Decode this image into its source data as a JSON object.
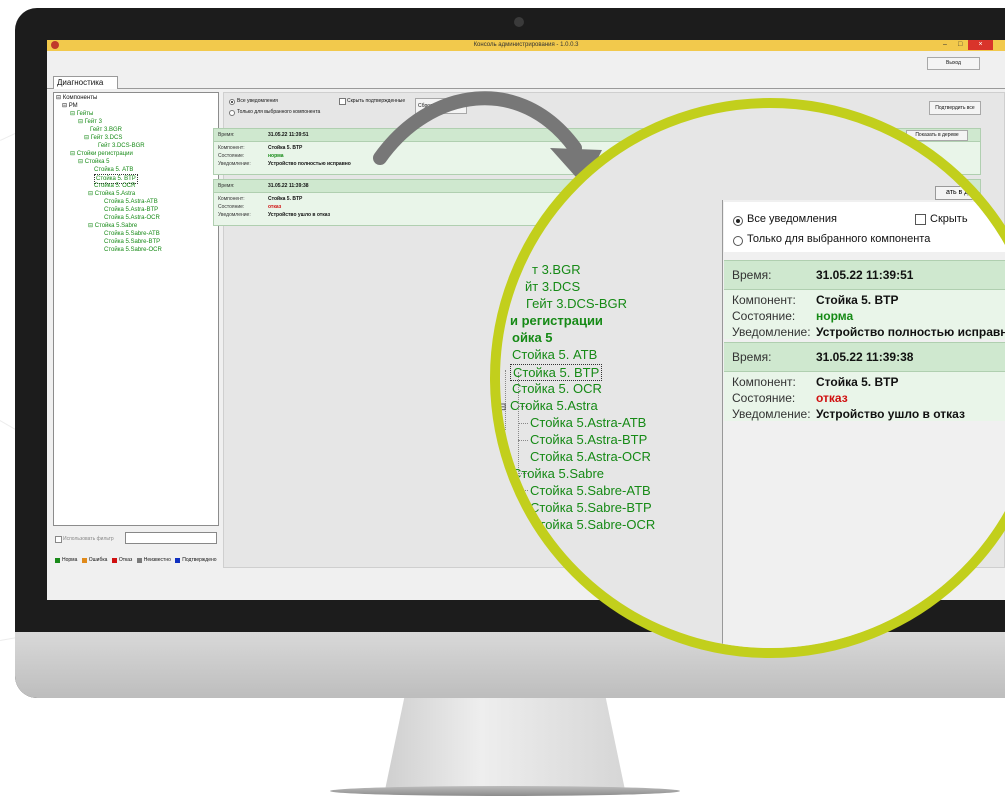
{
  "window": {
    "title": "Консоль администрирования - 1.0.0.3",
    "minimize_glyph": "–",
    "maximize_glyph": "□",
    "close_glyph": "×",
    "exit_label": "Выход"
  },
  "tabs": [
    "Диагностика"
  ],
  "tree": {
    "root": "Компоненты",
    "pm": "РМ",
    "gates": "Гейты",
    "gate3": "Гейт 3",
    "gate3_bgr": "Гейт 3.BGR",
    "gate3_dcs": "Гейт 3.DCS",
    "gate3_dcs_bgr": "Гейт 3.DCS-BGR",
    "counters": "Стойки регистрации",
    "counter5": "Стойка 5",
    "counter5_atb": "Стойка 5. ATB",
    "counter5_btp": "Стойка 5. BTP",
    "counter5_ocr": "Стойка 5. OCR",
    "counter5_astra": "Стойка 5.Astra",
    "astra_atb": "Стойка 5.Astra-ATB",
    "astra_btp": "Стойка 5.Astra-BTP",
    "astra_ocr": "Стойка 5.Astra-OCR",
    "counter5_sabre": "Стойка 5.Sabre",
    "sabre_atb": "Стойка 5.Sabre-ATB",
    "sabre_btp": "Стойка 5.Sabre-BTP",
    "sabre_ocr": "Стойка 5.Sabre-OCR",
    "expander": "⊟"
  },
  "filter": {
    "label": "Использовать фильтр"
  },
  "legend": [
    {
      "label": "Норма",
      "color": "#1a8a1a"
    },
    {
      "label": "Ошибка",
      "color": "#e08a1a"
    },
    {
      "label": "Отказ",
      "color": "#d01010"
    },
    {
      "label": "Неизвестно",
      "color": "#7a7a7a"
    },
    {
      "label": "Подтверждено",
      "color": "#1030c0"
    }
  ],
  "notifications": {
    "all_label": "Все уведомления",
    "selected_only_label": "Только для выбранного компонента",
    "hide_confirmed_label": "Скрыть подтвержденные",
    "zoom_hide_label": "Скрыть",
    "reset_label": "Сбросить",
    "confirm_all_label": "Подтвердить все",
    "show_in_tree_label": "Показать в дереве",
    "zoom_show_in_tree_fragment": "ать в дереве",
    "keys": {
      "time": "Время:",
      "component": "Компонент:",
      "state": "Состояние:",
      "notice": "Уведомление:"
    },
    "items": [
      {
        "time": "31.05.22 11:39:51",
        "component": "Стойка 5. BTP",
        "state": "норма",
        "notice": "Устройство полностью исправно",
        "zoom_notice": "Устройство полностью исправн"
      },
      {
        "time": "31.05.22 11:39:38",
        "component": "Стойка 5. BTP",
        "state": "отказ",
        "notice": "Устройство ушло в отказ",
        "zoom_notice": "Устройство ушло в отказ"
      }
    ]
  },
  "zoom_tree": {
    "gate3_bgr": "т 3.BGR",
    "gate3_dcs": "йт 3.DCS",
    "gate3_dcs_bgr": "Гейт 3.DCS-BGR",
    "counters": "и регистрации",
    "counter5": "ойка 5",
    "expander": "⊟"
  },
  "colors": {
    "accent_lime": "#c2cf1c",
    "title_bar": "#f2c94c",
    "tree_green": "#168a16",
    "fail_red": "#d01010",
    "card_bg": "#e9f5e9",
    "card_head": "#cfe8cf"
  }
}
